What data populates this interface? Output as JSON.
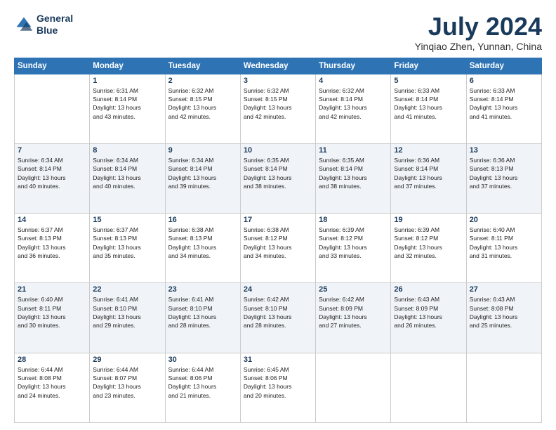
{
  "header": {
    "logo_line1": "General",
    "logo_line2": "Blue",
    "month_title": "July 2024",
    "location": "Yinqiao Zhen, Yunnan, China"
  },
  "days_of_week": [
    "Sunday",
    "Monday",
    "Tuesday",
    "Wednesday",
    "Thursday",
    "Friday",
    "Saturday"
  ],
  "weeks": [
    [
      {
        "num": "",
        "text": ""
      },
      {
        "num": "1",
        "text": "Sunrise: 6:31 AM\nSunset: 8:14 PM\nDaylight: 13 hours\nand 43 minutes."
      },
      {
        "num": "2",
        "text": "Sunrise: 6:32 AM\nSunset: 8:15 PM\nDaylight: 13 hours\nand 42 minutes."
      },
      {
        "num": "3",
        "text": "Sunrise: 6:32 AM\nSunset: 8:15 PM\nDaylight: 13 hours\nand 42 minutes."
      },
      {
        "num": "4",
        "text": "Sunrise: 6:32 AM\nSunset: 8:14 PM\nDaylight: 13 hours\nand 42 minutes."
      },
      {
        "num": "5",
        "text": "Sunrise: 6:33 AM\nSunset: 8:14 PM\nDaylight: 13 hours\nand 41 minutes."
      },
      {
        "num": "6",
        "text": "Sunrise: 6:33 AM\nSunset: 8:14 PM\nDaylight: 13 hours\nand 41 minutes."
      }
    ],
    [
      {
        "num": "7",
        "text": "Sunrise: 6:34 AM\nSunset: 8:14 PM\nDaylight: 13 hours\nand 40 minutes."
      },
      {
        "num": "8",
        "text": "Sunrise: 6:34 AM\nSunset: 8:14 PM\nDaylight: 13 hours\nand 40 minutes."
      },
      {
        "num": "9",
        "text": "Sunrise: 6:34 AM\nSunset: 8:14 PM\nDaylight: 13 hours\nand 39 minutes."
      },
      {
        "num": "10",
        "text": "Sunrise: 6:35 AM\nSunset: 8:14 PM\nDaylight: 13 hours\nand 38 minutes."
      },
      {
        "num": "11",
        "text": "Sunrise: 6:35 AM\nSunset: 8:14 PM\nDaylight: 13 hours\nand 38 minutes."
      },
      {
        "num": "12",
        "text": "Sunrise: 6:36 AM\nSunset: 8:14 PM\nDaylight: 13 hours\nand 37 minutes."
      },
      {
        "num": "13",
        "text": "Sunrise: 6:36 AM\nSunset: 8:13 PM\nDaylight: 13 hours\nand 37 minutes."
      }
    ],
    [
      {
        "num": "14",
        "text": "Sunrise: 6:37 AM\nSunset: 8:13 PM\nDaylight: 13 hours\nand 36 minutes."
      },
      {
        "num": "15",
        "text": "Sunrise: 6:37 AM\nSunset: 8:13 PM\nDaylight: 13 hours\nand 35 minutes."
      },
      {
        "num": "16",
        "text": "Sunrise: 6:38 AM\nSunset: 8:13 PM\nDaylight: 13 hours\nand 34 minutes."
      },
      {
        "num": "17",
        "text": "Sunrise: 6:38 AM\nSunset: 8:12 PM\nDaylight: 13 hours\nand 34 minutes."
      },
      {
        "num": "18",
        "text": "Sunrise: 6:39 AM\nSunset: 8:12 PM\nDaylight: 13 hours\nand 33 minutes."
      },
      {
        "num": "19",
        "text": "Sunrise: 6:39 AM\nSunset: 8:12 PM\nDaylight: 13 hours\nand 32 minutes."
      },
      {
        "num": "20",
        "text": "Sunrise: 6:40 AM\nSunset: 8:11 PM\nDaylight: 13 hours\nand 31 minutes."
      }
    ],
    [
      {
        "num": "21",
        "text": "Sunrise: 6:40 AM\nSunset: 8:11 PM\nDaylight: 13 hours\nand 30 minutes."
      },
      {
        "num": "22",
        "text": "Sunrise: 6:41 AM\nSunset: 8:10 PM\nDaylight: 13 hours\nand 29 minutes."
      },
      {
        "num": "23",
        "text": "Sunrise: 6:41 AM\nSunset: 8:10 PM\nDaylight: 13 hours\nand 28 minutes."
      },
      {
        "num": "24",
        "text": "Sunrise: 6:42 AM\nSunset: 8:10 PM\nDaylight: 13 hours\nand 28 minutes."
      },
      {
        "num": "25",
        "text": "Sunrise: 6:42 AM\nSunset: 8:09 PM\nDaylight: 13 hours\nand 27 minutes."
      },
      {
        "num": "26",
        "text": "Sunrise: 6:43 AM\nSunset: 8:09 PM\nDaylight: 13 hours\nand 26 minutes."
      },
      {
        "num": "27",
        "text": "Sunrise: 6:43 AM\nSunset: 8:08 PM\nDaylight: 13 hours\nand 25 minutes."
      }
    ],
    [
      {
        "num": "28",
        "text": "Sunrise: 6:44 AM\nSunset: 8:08 PM\nDaylight: 13 hours\nand 24 minutes."
      },
      {
        "num": "29",
        "text": "Sunrise: 6:44 AM\nSunset: 8:07 PM\nDaylight: 13 hours\nand 23 minutes."
      },
      {
        "num": "30",
        "text": "Sunrise: 6:44 AM\nSunset: 8:06 PM\nDaylight: 13 hours\nand 21 minutes."
      },
      {
        "num": "31",
        "text": "Sunrise: 6:45 AM\nSunset: 8:06 PM\nDaylight: 13 hours\nand 20 minutes."
      },
      {
        "num": "",
        "text": ""
      },
      {
        "num": "",
        "text": ""
      },
      {
        "num": "",
        "text": ""
      }
    ]
  ]
}
